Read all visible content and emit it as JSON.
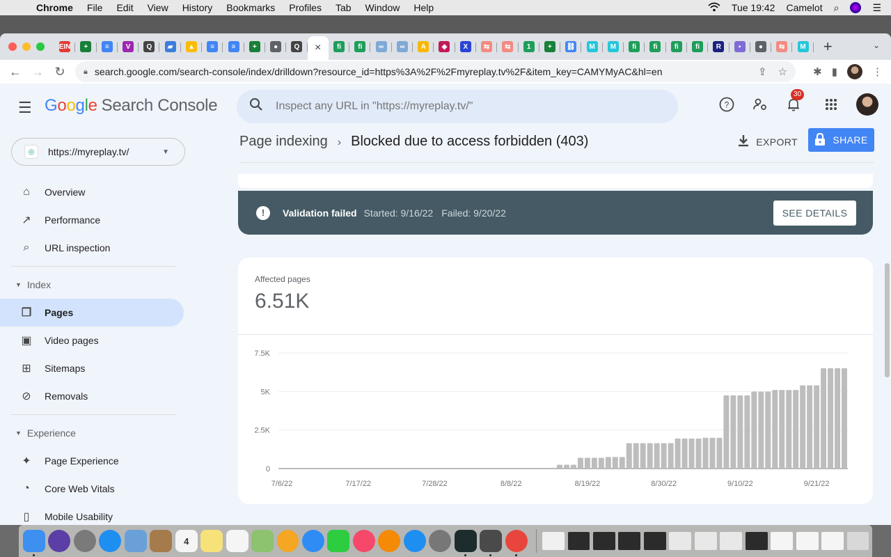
{
  "menubar": {
    "apple_icon": "apple-icon",
    "app_name": "Chrome",
    "items": [
      "File",
      "Edit",
      "View",
      "History",
      "Bookmarks",
      "Profiles",
      "Tab",
      "Window",
      "Help"
    ],
    "clock": "Tue 19:42",
    "user": "Camelot"
  },
  "browser": {
    "tabs": [
      {
        "icon": "ein-icon",
        "color": "#e53935",
        "glyph": "EIN"
      },
      {
        "icon": "sheets-icon",
        "color": "#188038",
        "glyph": "+"
      },
      {
        "icon": "docs-icon",
        "color": "#4285f4",
        "glyph": "≡"
      },
      {
        "icon": "v-icon",
        "color": "#9c27b0",
        "glyph": "V"
      },
      {
        "icon": "q-icon",
        "color": "#444",
        "glyph": "Q"
      },
      {
        "icon": "folder-icon",
        "color": "#3b7ddd",
        "glyph": "▰"
      },
      {
        "icon": "drive-icon",
        "color": "#fbbc05",
        "glyph": "▲"
      },
      {
        "icon": "docs-icon",
        "color": "#4285f4",
        "glyph": "≡"
      },
      {
        "icon": "docs-icon",
        "color": "#4285f4",
        "glyph": "≡"
      },
      {
        "icon": "sheets-icon",
        "color": "#188038",
        "glyph": "+"
      },
      {
        "icon": "globe-icon",
        "color": "#5f6368",
        "glyph": "●"
      },
      {
        "icon": "q-icon",
        "color": "#444",
        "glyph": "Q"
      },
      {
        "icon": "close-icon",
        "color": "transparent",
        "glyph": "×",
        "active": true
      },
      {
        "icon": "fi-icon",
        "color": "#1e9e5a",
        "glyph": "fi"
      },
      {
        "icon": "fi-icon",
        "color": "#1e9e5a",
        "glyph": "fi"
      },
      {
        "icon": "link-icon",
        "color": "#7fa9d6",
        "glyph": "∞"
      },
      {
        "icon": "link-icon",
        "color": "#7fa9d6",
        "glyph": "∞"
      },
      {
        "icon": "a-icon",
        "color": "#f9b800",
        "glyph": "A"
      },
      {
        "icon": "shield-icon",
        "color": "#c2185b",
        "glyph": "◈"
      },
      {
        "icon": "x-icon",
        "color": "#2b44d6",
        "glyph": "X"
      },
      {
        "icon": "swap-icon",
        "color": "#f28b82",
        "glyph": "⇆"
      },
      {
        "icon": "swap-icon",
        "color": "#f28b82",
        "glyph": "⇆"
      },
      {
        "icon": "one-icon",
        "color": "#1e9e5a",
        "glyph": "1"
      },
      {
        "icon": "sheets-icon",
        "color": "#188038",
        "glyph": "+"
      },
      {
        "icon": "chain-icon",
        "color": "#4285f4",
        "glyph": "⛓"
      },
      {
        "icon": "m-icon",
        "color": "#26c6da",
        "glyph": "M"
      },
      {
        "icon": "m-icon",
        "color": "#26c6da",
        "glyph": "M"
      },
      {
        "icon": "fi-icon",
        "color": "#1e9e5a",
        "glyph": "fi"
      },
      {
        "icon": "fi-icon",
        "color": "#1e9e5a",
        "glyph": "fi"
      },
      {
        "icon": "fi-icon",
        "color": "#1e9e5a",
        "glyph": "fi"
      },
      {
        "icon": "fi-icon",
        "color": "#1e9e5a",
        "glyph": "fi"
      },
      {
        "icon": "r-icon",
        "color": "#1a237e",
        "glyph": "R"
      },
      {
        "icon": "chat-icon",
        "color": "#7e6bd6",
        "glyph": "▪"
      },
      {
        "icon": "globe-icon",
        "color": "#5f6368",
        "glyph": "●"
      },
      {
        "icon": "swap-icon",
        "color": "#f28b82",
        "glyph": "⇆"
      },
      {
        "icon": "m-icon",
        "color": "#26c6da",
        "glyph": "M"
      }
    ],
    "url": "search.google.com/search-console/index/drilldown?resource_id=https%3A%2F%2Fmyreplay.tv%2F&item_key=CAMYMyAC&hl=en"
  },
  "app": {
    "logo_google": [
      "G",
      "o",
      "o",
      "g",
      "l",
      "e"
    ],
    "logo_product": "Search Console",
    "search_placeholder": "Inspect any URL in \"https://myreplay.tv/\"",
    "notifications_count": "30",
    "property": "https://myreplay.tv/"
  },
  "sidebar": {
    "items_top": [
      {
        "label": "Overview",
        "icon": "home-icon",
        "glyph": "⌂"
      },
      {
        "label": "Performance",
        "icon": "trending-icon",
        "glyph": "↗"
      },
      {
        "label": "URL inspection",
        "icon": "search-icon",
        "glyph": "⌕"
      }
    ],
    "index_section": "Index",
    "index_items": [
      {
        "label": "Pages",
        "icon": "pages-icon",
        "glyph": "❐",
        "active": true
      },
      {
        "label": "Video pages",
        "icon": "video-pages-icon",
        "glyph": "▣"
      },
      {
        "label": "Sitemaps",
        "icon": "sitemap-icon",
        "glyph": "⊞"
      },
      {
        "label": "Removals",
        "icon": "visibility-off-icon",
        "glyph": "⊘"
      }
    ],
    "experience_section": "Experience",
    "experience_items": [
      {
        "label": "Page Experience",
        "icon": "page-experience-icon",
        "glyph": "✦"
      },
      {
        "label": "Core Web Vitals",
        "icon": "gauge-icon",
        "glyph": "◔"
      },
      {
        "label": "Mobile Usability",
        "icon": "phone-icon",
        "glyph": "▯"
      }
    ]
  },
  "breadcrumb": {
    "parent": "Page indexing",
    "current": "Blocked due to access forbidden (403)"
  },
  "actions": {
    "export": "EXPORT",
    "share": "SHARE"
  },
  "validation": {
    "title": "Validation failed",
    "started": "Started: 9/16/22",
    "failed": "Failed: 9/20/22",
    "button": "SEE DETAILS"
  },
  "summary": {
    "label": "Affected pages",
    "value": "6.51K"
  },
  "chart_data": {
    "type": "bar",
    "title": "Affected pages",
    "xlabel": "",
    "ylabel": "",
    "ylim": [
      0,
      7500
    ],
    "yticks": [
      0,
      2500,
      5000,
      7500
    ],
    "ytick_labels": [
      "0",
      "2.5K",
      "5K",
      "7.5K"
    ],
    "xtick_labels": [
      "7/6/22",
      "7/17/22",
      "7/28/22",
      "8/8/22",
      "8/19/22",
      "8/30/22",
      "9/10/22",
      "9/21/22"
    ],
    "x_start": "7/6/22",
    "days": 82,
    "first_nonzero_day_index": 40,
    "values": [
      250,
      250,
      250,
      700,
      700,
      700,
      700,
      750,
      750,
      750,
      1650,
      1650,
      1650,
      1650,
      1650,
      1650,
      1650,
      1950,
      1950,
      1950,
      1950,
      2000,
      2000,
      2000,
      4750,
      4750,
      4750,
      4750,
      5000,
      5000,
      5000,
      5100,
      5100,
      5100,
      5100,
      5400,
      5400,
      5400,
      6510,
      6510,
      6510,
      6510
    ],
    "color": "#bdbdbd",
    "grid": true
  },
  "dock": {
    "apps": [
      {
        "name": "finder-icon",
        "color": "#3d8ff0",
        "running": true
      },
      {
        "name": "siri-icon",
        "color": "#5b3ea6"
      },
      {
        "name": "launchpad-icon",
        "color": "#7a7a7a"
      },
      {
        "name": "safari-icon",
        "color": "#1f8ef1"
      },
      {
        "name": "mail-icon",
        "color": "#6aa0d8"
      },
      {
        "name": "contacts-icon",
        "color": "#a67b4b"
      },
      {
        "name": "calendar-icon",
        "color": "#f5f5f5",
        "label": "4"
      },
      {
        "name": "notes-icon",
        "color": "#f7e27a"
      },
      {
        "name": "reminders-icon",
        "color": "#f5f5f5"
      },
      {
        "name": "maps-icon",
        "color": "#8dc26f"
      },
      {
        "name": "photos-icon",
        "color": "#f5a623"
      },
      {
        "name": "messages-icon",
        "color": "#2f8cf5"
      },
      {
        "name": "facetime-icon",
        "color": "#2ecc40"
      },
      {
        "name": "music-icon",
        "color": "#f5486a"
      },
      {
        "name": "books-icon",
        "color": "#f58a07"
      },
      {
        "name": "app-store-icon",
        "color": "#1f8ef1"
      },
      {
        "name": "system-preferences-icon",
        "color": "#777"
      },
      {
        "name": "activity-monitor-icon",
        "color": "#1d2d2d",
        "running": true
      },
      {
        "name": "sublime-text-icon",
        "color": "#4a4a4a",
        "running": true
      },
      {
        "name": "chrome-icon",
        "color": "#e8453c",
        "running": true
      }
    ],
    "docs": [
      {
        "name": "document-icon",
        "color": "#f0f0f0"
      },
      {
        "name": "window-thumb-icon",
        "color": "#2b2b2b"
      },
      {
        "name": "window-thumb-icon",
        "color": "#2b2b2b"
      },
      {
        "name": "window-thumb-icon",
        "color": "#2b2b2b"
      },
      {
        "name": "window-thumb-icon",
        "color": "#2b2b2b"
      },
      {
        "name": "window-thumb-icon",
        "color": "#e8e8e8"
      },
      {
        "name": "window-thumb-icon",
        "color": "#e8e8e8"
      },
      {
        "name": "window-thumb-icon",
        "color": "#e8e8e8"
      },
      {
        "name": "window-thumb-icon",
        "color": "#2b2b2b"
      },
      {
        "name": "window-thumb-icon",
        "color": "#f5f5f5"
      },
      {
        "name": "window-thumb-icon",
        "color": "#f5f5f5"
      },
      {
        "name": "window-thumb-icon",
        "color": "#f5f5f5"
      },
      {
        "name": "trash-icon",
        "color": "#d8d8d8"
      }
    ]
  }
}
